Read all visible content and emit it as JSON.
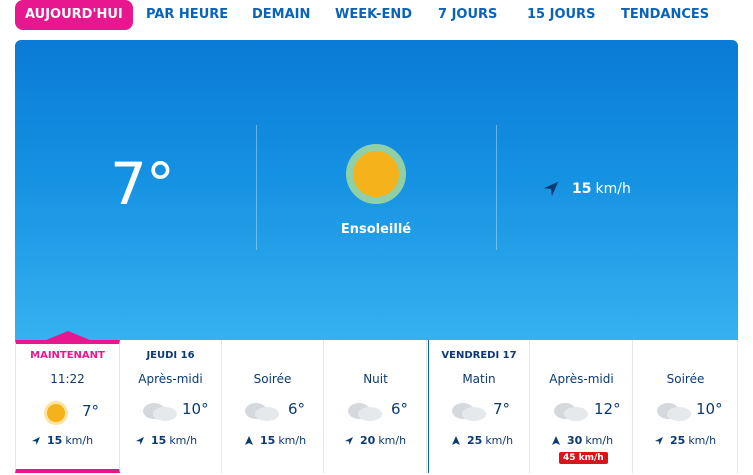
{
  "tabs": [
    {
      "label": "AUJOURD'HUI",
      "active": true
    },
    {
      "label": "PAR HEURE"
    },
    {
      "label": "DEMAIN"
    },
    {
      "label": "WEEK-END"
    },
    {
      "label": "7 JOURS"
    },
    {
      "label": "15 JOURS"
    },
    {
      "label": "TENDANCES"
    }
  ],
  "current": {
    "temperature": "7°",
    "condition": "Ensoleillé",
    "icon": "sun-icon",
    "wind_speed": "15",
    "wind_unit": "km/h"
  },
  "forecast": [
    {
      "day": "MAINTENANT",
      "label": "11:22",
      "icon": "sun-icon",
      "temp": "7°",
      "wind": "15",
      "unit": "km/h"
    },
    {
      "day": "JEUDI 16",
      "label": "Après-midi",
      "icon": "cloud-icon",
      "temp": "10°",
      "wind": "15",
      "unit": "km/h"
    },
    {
      "day": "",
      "label": "Soirée",
      "icon": "cloud-icon",
      "temp": "6°",
      "wind": "15",
      "unit": "km/h"
    },
    {
      "day": "",
      "label": "Nuit",
      "icon": "cloud-icon",
      "temp": "6°",
      "wind": "20",
      "unit": "km/h"
    },
    {
      "day": "VENDREDI 17",
      "label": "Matin",
      "icon": "cloud-icon",
      "temp": "7°",
      "wind": "25",
      "unit": "km/h"
    },
    {
      "day": "",
      "label": "Après-midi",
      "icon": "cloud-icon",
      "temp": "12°",
      "wind": "30",
      "unit": "km/h",
      "gust": "45 km/h"
    },
    {
      "day": "",
      "label": "Soirée",
      "icon": "cloud-icon",
      "temp": "10°",
      "wind": "25",
      "unit": "km/h"
    }
  ],
  "colors": {
    "accent": "#e8168f",
    "primary": "#0a63b8",
    "gust": "#d9141b",
    "sun": "#f6b21b"
  }
}
